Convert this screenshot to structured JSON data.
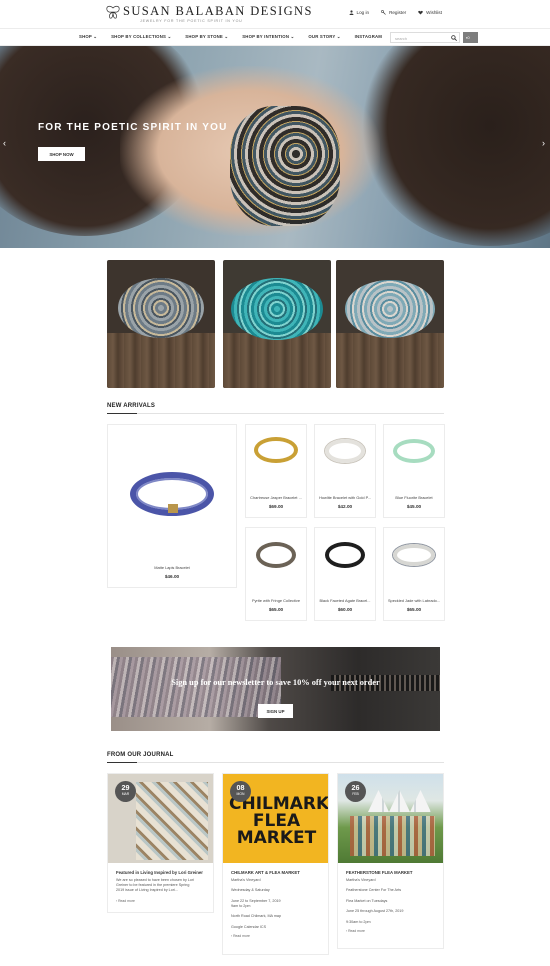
{
  "brand": {
    "name": "SUSAN BALABAN DESIGNS",
    "tagline": "JEWELRY FOR THE POETIC SPIRIT IN YOU"
  },
  "topnav": {
    "login": "Log in",
    "register": "Register",
    "wishlist": "Wishlist"
  },
  "nav": {
    "items": [
      "SHOP",
      "SHOP BY COLLECTIONS",
      "SHOP BY STONE",
      "SHOP BY INTENTION",
      "OUR STORY",
      "INSTAGRAM"
    ],
    "search_placeholder": "search",
    "cart_count": "0"
  },
  "hero": {
    "title": "FOR THE POETIC SPIRIT IN YOU",
    "button": "SHOP NOW"
  },
  "new_arrivals": {
    "title": "NEW ARRIVALS",
    "featured": {
      "name": "Matte Lapis Bracelet",
      "price": "$46.00"
    },
    "products": [
      {
        "name": "Chartreuse Jasper Bracelet ...",
        "price": "$69.00"
      },
      {
        "name": "Howlite Bracelet with Gold P...",
        "price": "$42.00"
      },
      {
        "name": "Blue Fluorite Bracelet",
        "price": "$45.00"
      },
      {
        "name": "Pyrite with Fringe Collective",
        "price": "$65.00"
      },
      {
        "name": "Black Faceted Agate Bracel...",
        "price": "$60.00"
      },
      {
        "name": "Speckled Jade with Labrado...",
        "price": "$65.00"
      }
    ]
  },
  "newsletter": {
    "text": "Sign up for our newsletter to save 10% off your next order",
    "button": "SIGN UP"
  },
  "journal": {
    "title": "FROM OUR JOURNAL",
    "poster": "CHILMARK FLEA MARKET",
    "posts": [
      {
        "day": "29",
        "month": "MAR",
        "title": "Featured in Living Inspired by Lori Greiner",
        "lines": [
          "We are so pleased to have been chosen by Lori",
          "Greiner to be featured in the premiere Spring",
          "2019 issue of Living Inspired by Lori..."
        ],
        "more": "Read more"
      },
      {
        "day": "08",
        "month": "MON",
        "title": "CHILMARK ART & FLEA MARKET",
        "lines": [
          "Martha's Vineyard",
          "",
          "Wednesday & Saturday",
          "",
          "June 22 to September 7, 2019",
          "9am to 2pm",
          "",
          "North Road Chilmark, MA map",
          "",
          "Google Calendar ICS"
        ],
        "more": "Read more"
      },
      {
        "day": "26",
        "month": "FEB",
        "title": "FEATHERSTONE FLEA MARKET",
        "lines": [
          "Martha's Vineyard",
          "",
          "Featherstone Center For The Arts",
          "",
          "Flea Market on Tuesdays",
          "",
          "June 25 through August 27th, 2019",
          "",
          "9:30am to 2pm"
        ],
        "more": "Read more"
      }
    ]
  }
}
